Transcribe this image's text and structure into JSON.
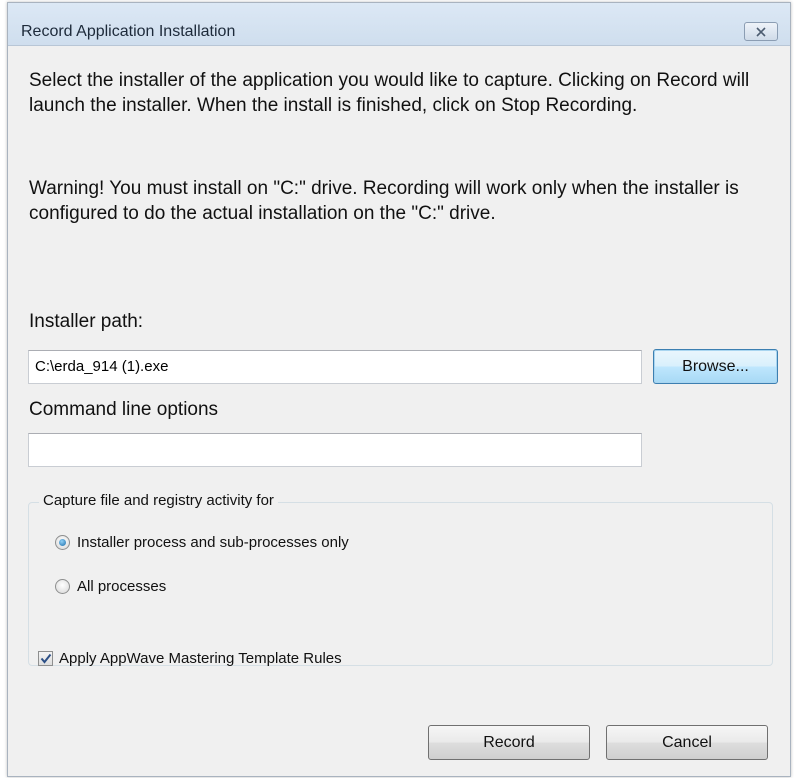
{
  "window": {
    "title": "Record Application Installation"
  },
  "instructions": {
    "paragraph1": "Select the installer of the application you would like to capture.  Clicking on Record will  launch the installer.  When the install is finished, click on Stop Recording.",
    "warning": "Warning! You must install on \"C:\" drive. Recording will work only when the installer is configured to do the actual installation on the \"C:\" drive."
  },
  "installer_path": {
    "label": "Installer path:",
    "value": "C:\\erda_914 (1).exe",
    "browse_label": "Browse..."
  },
  "command_line": {
    "label": "Command line options",
    "value": ""
  },
  "capture_group": {
    "legend": "Capture file and registry activity for",
    "options": [
      {
        "label": "Installer process and sub-processes only",
        "selected": true
      },
      {
        "label": "All processes",
        "selected": false
      }
    ]
  },
  "template_rules": {
    "label": "Apply AppWave Mastering Template Rules",
    "checked": true
  },
  "footer": {
    "record_label": "Record",
    "cancel_label": "Cancel"
  },
  "colors": {
    "dialog_background": "#f0f0f0",
    "radio_selected": "#1b6ca8",
    "focused_button_border": "#3c7fb1"
  }
}
